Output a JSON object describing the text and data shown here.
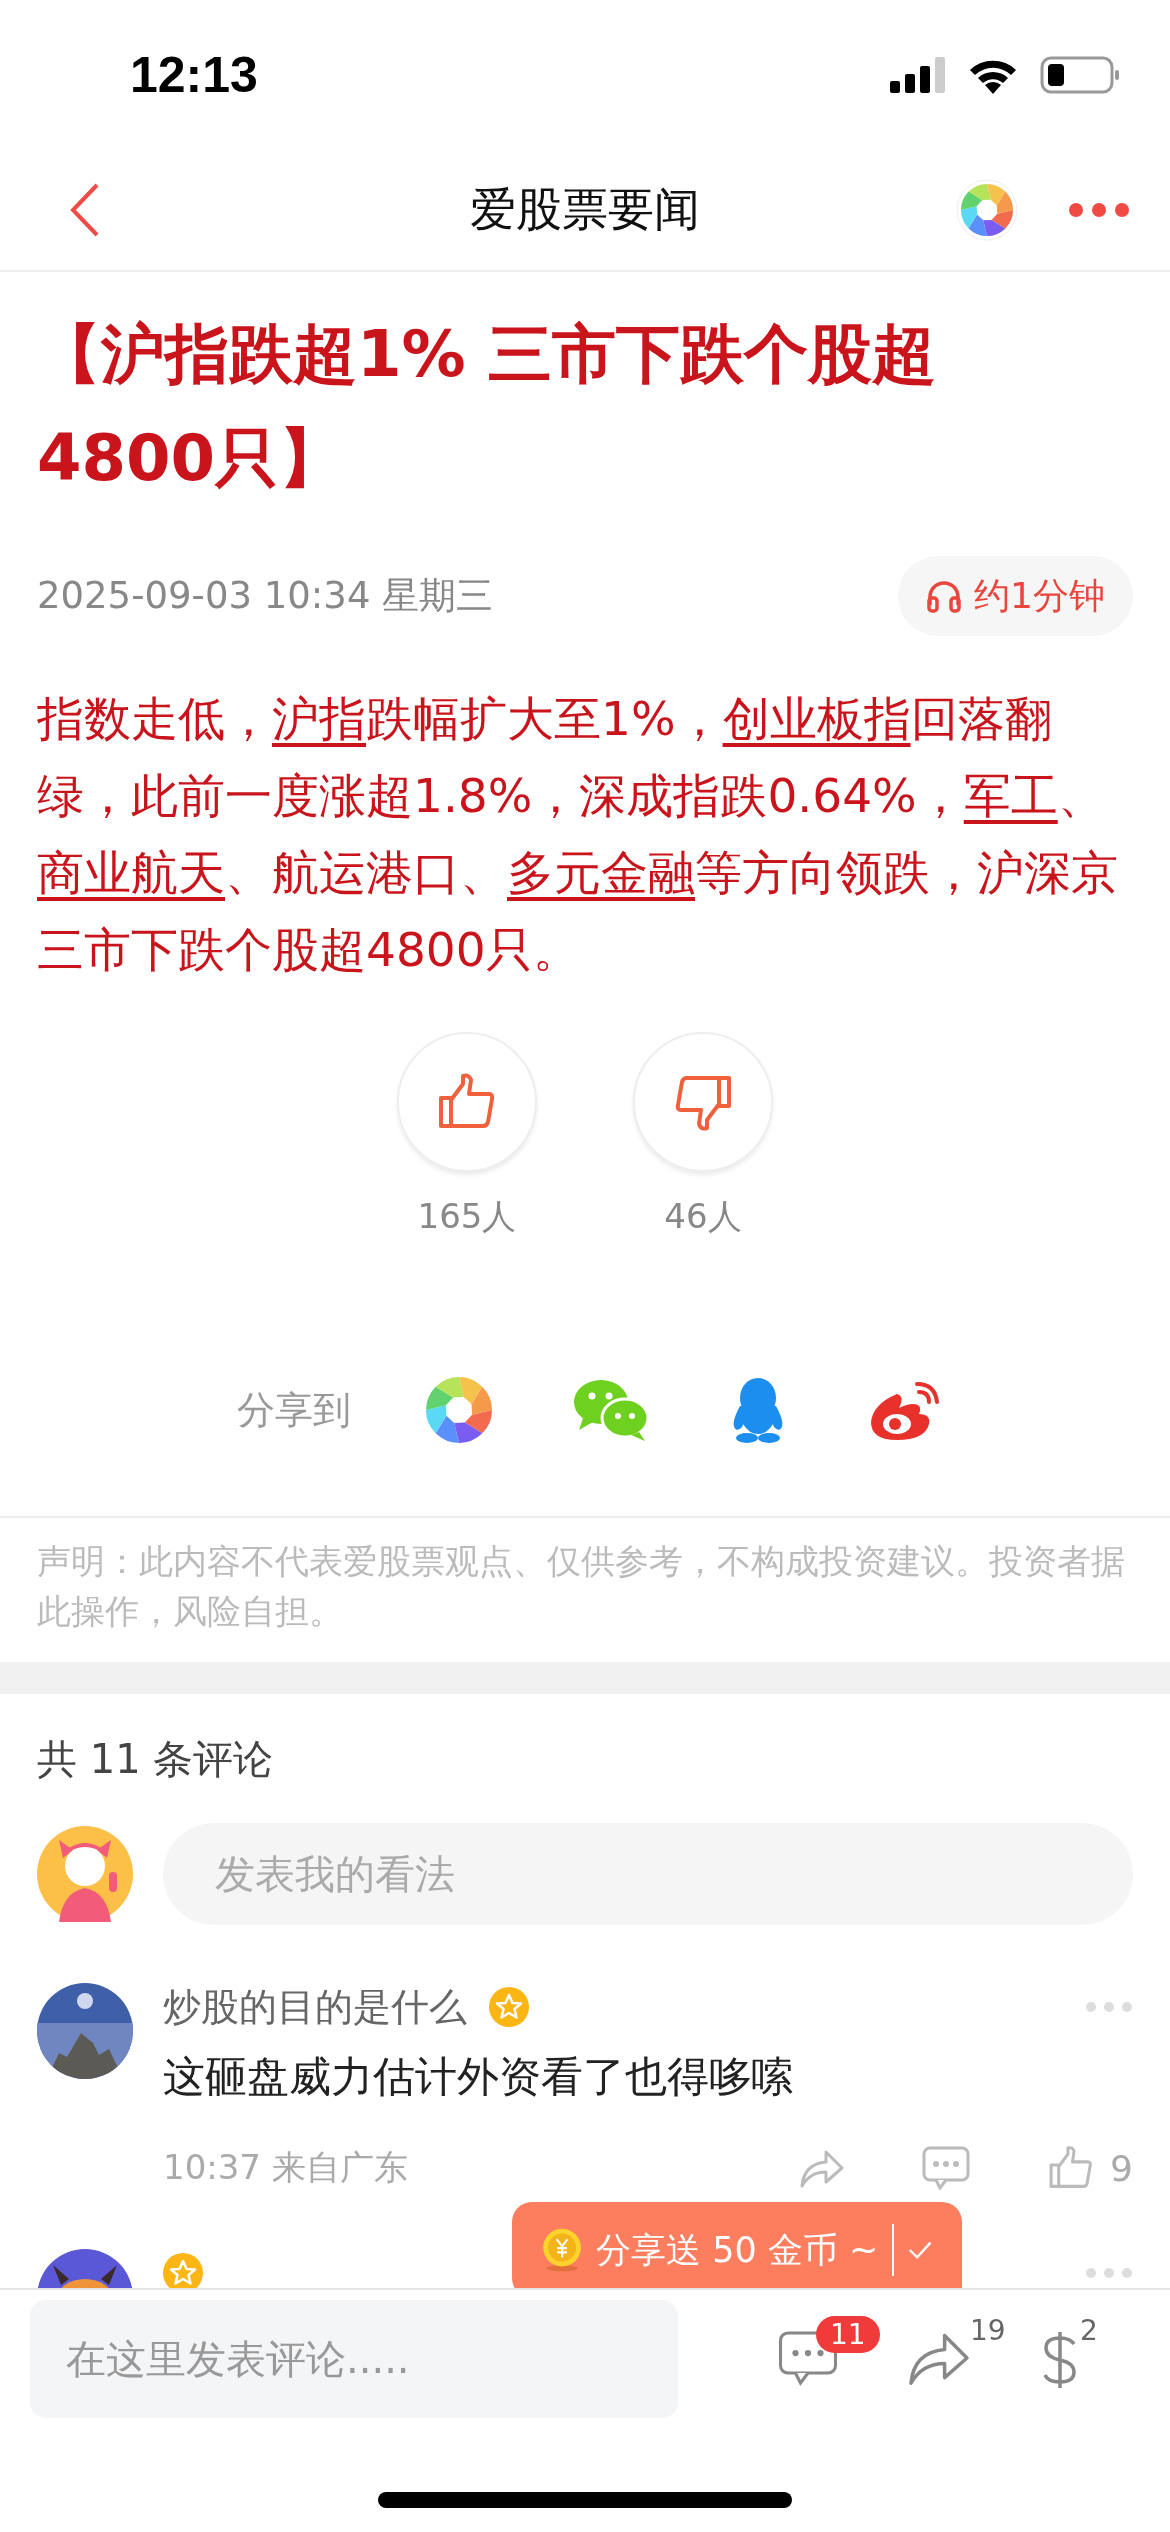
{
  "status_bar": {
    "time": "12:13"
  },
  "nav": {
    "title": "爱股票要闻"
  },
  "article": {
    "headline": "【沪指跌超1% 三市下跌个股超4800只】",
    "date": "2025-09-03 10:34 星期三",
    "listen": "约1分钟",
    "body": [
      {
        "text": "指数走低，",
        "link": false
      },
      {
        "text": "沪指",
        "link": true
      },
      {
        "text": "跌幅扩大至1%，",
        "link": false
      },
      {
        "text": "创业板指",
        "link": true
      },
      {
        "text": "回落翻绿，此前一度涨超1.8%，深成指跌0.64%，",
        "link": false
      },
      {
        "text": "军工",
        "link": true
      },
      {
        "text": "、",
        "link": false
      },
      {
        "text": "商业航天",
        "link": true
      },
      {
        "text": "、航运港口、",
        "link": false
      },
      {
        "text": "多元金融",
        "link": true
      },
      {
        "text": "等方向领跌，沪深京三市下跌个股超4800只。",
        "link": false
      }
    ]
  },
  "reactions": [
    {
      "kind": "like",
      "count": "165人"
    },
    {
      "kind": "dislike",
      "count": "46人"
    }
  ],
  "share": {
    "label": "分享到"
  },
  "disclaimer": "声明：此内容不代表爱股票观点、仅供参考，不构成投资建议。投资者据此操作，风险自担。",
  "comments_header": "共 11 条评论",
  "comment_input": {
    "placeholder": "发表我的看法"
  },
  "comments": [
    {
      "user": "炒股的目的是什么",
      "verified": true,
      "text": "这砸盘威力估计外资看了也得哆嗦",
      "meta": "10:37 来自广东",
      "likes": "9"
    },
    {
      "verified": true
    }
  ],
  "popup": {
    "text": "分享送 50 金币 ~"
  },
  "bottom_bar": {
    "placeholder": "在这里发表评论.....",
    "comment_count": "11",
    "share_count": "19",
    "tip_count": "2"
  }
}
